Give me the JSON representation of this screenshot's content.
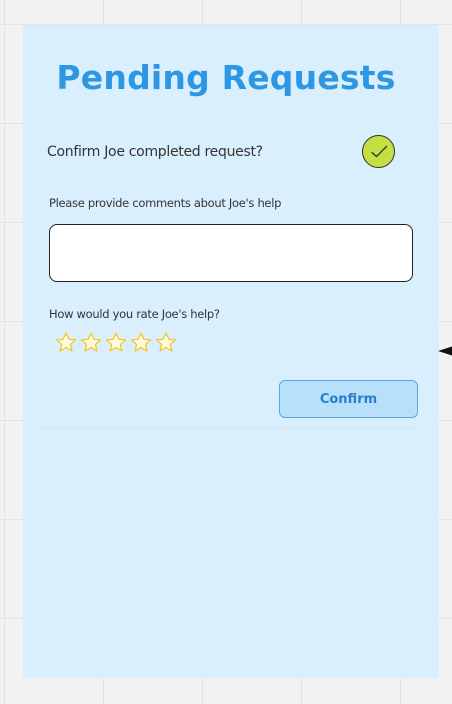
{
  "page": {
    "title": "Pending Requests"
  },
  "completion": {
    "question": "Confirm Joe completed request?",
    "checkbox_icon": "check-circle-icon",
    "checked": true
  },
  "comments": {
    "label": "Please provide comments about Joe's help",
    "value": "",
    "placeholder": ""
  },
  "rating": {
    "label": "How would you rate Joe's help?",
    "icon": "star-outline-icon",
    "max": 5,
    "value": 0
  },
  "actions": {
    "confirm_label": "Confirm"
  },
  "colors": {
    "canvas_background": "#f2f2f2",
    "panel_background": "#daeffd",
    "title": "#2d97e3",
    "check_fill": "#c3e043",
    "star_fill": "#fffbe0",
    "star_stroke": "#f2c318",
    "button_background": "#b8e0fb",
    "button_text": "#2680cc"
  }
}
